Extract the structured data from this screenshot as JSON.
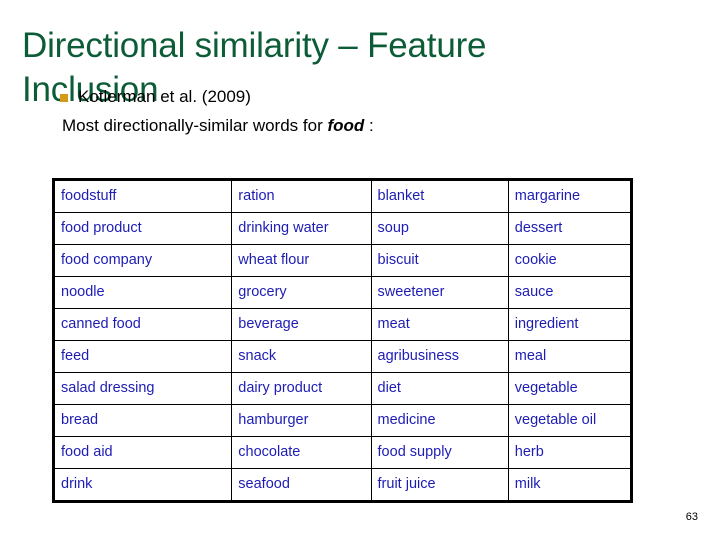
{
  "slide": {
    "title": "Directional similarity – Feature Inclusion",
    "page_number": "63",
    "title_color": "#0d5c38",
    "bullet_marker_color": "#d49a16",
    "word_color": "#1d1db4",
    "highlight_color": "#4c7a4c"
  },
  "body": {
    "bullet": "Kotlerman et al. (2009)",
    "sub_prefix": "Most directionally-similar words for ",
    "sub_keyword": "food",
    "sub_suffix": " :"
  },
  "table": {
    "rows": [
      [
        {
          "text": "foodstuff",
          "highlight": false
        },
        {
          "text": "ration",
          "highlight": false
        },
        {
          "text": "blanket",
          "highlight": true
        },
        {
          "text": "margarine",
          "highlight": false
        }
      ],
      [
        {
          "text": "food product",
          "highlight": false
        },
        {
          "text": "drinking water",
          "highlight": false
        },
        {
          "text": "soup",
          "highlight": false
        },
        {
          "text": "dessert",
          "highlight": false
        }
      ],
      [
        {
          "text": "food company",
          "highlight": false
        },
        {
          "text": "wheat flour",
          "highlight": false
        },
        {
          "text": "biscuit",
          "highlight": false
        },
        {
          "text": "cookie",
          "highlight": false
        }
      ],
      [
        {
          "text": "noodle",
          "highlight": false
        },
        {
          "text": "grocery",
          "highlight": false
        },
        {
          "text": "sweetener",
          "highlight": false
        },
        {
          "text": "sauce",
          "highlight": false
        }
      ],
      [
        {
          "text": "canned food",
          "highlight": false
        },
        {
          "text": "beverage",
          "highlight": false
        },
        {
          "text": "meat",
          "highlight": false
        },
        {
          "text": "ingredient",
          "highlight": false
        }
      ],
      [
        {
          "text": "feed",
          "highlight": false
        },
        {
          "text": "snack",
          "highlight": false
        },
        {
          "text": "agribusiness",
          "highlight": true
        },
        {
          "text": "meal",
          "highlight": false
        }
      ],
      [
        {
          "text": "salad dressing",
          "highlight": false
        },
        {
          "text": "dairy product",
          "highlight": false
        },
        {
          "text": "diet",
          "highlight": false
        },
        {
          "text": "vegetable",
          "highlight": false
        }
      ],
      [
        {
          "text": "bread",
          "highlight": false
        },
        {
          "text": "hamburger",
          "highlight": false
        },
        {
          "text": "medicine",
          "highlight": true
        },
        {
          "text": "vegetable oil",
          "highlight": false
        }
      ],
      [
        {
          "text": "food aid",
          "highlight": false
        },
        {
          "text": "chocolate",
          "highlight": false
        },
        {
          "text": "food supply",
          "highlight": false
        },
        {
          "text": "herb",
          "highlight": false
        }
      ],
      [
        {
          "text": "drink",
          "highlight": false
        },
        {
          "text": "seafood",
          "highlight": false
        },
        {
          "text": "fruit juice",
          "highlight": false
        },
        {
          "text": "milk",
          "highlight": false
        }
      ]
    ]
  }
}
